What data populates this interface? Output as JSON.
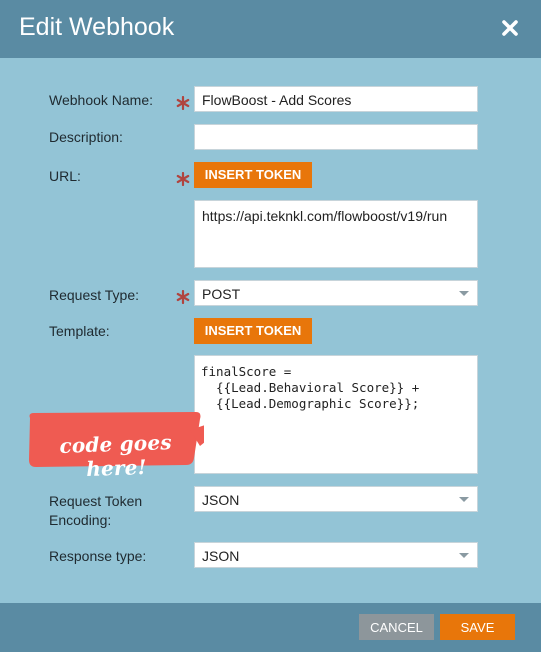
{
  "dialog": {
    "title": "Edit Webhook",
    "close_icon": "close-icon"
  },
  "form": {
    "webhook_name": {
      "label": "Webhook Name:",
      "value": "FlowBoost - Add Scores",
      "required": true
    },
    "description": {
      "label": "Description:",
      "value": ""
    },
    "url": {
      "label": "URL:",
      "insert_token": "INSERT TOKEN",
      "value": "https://api.teknkl.com/flowboost/v19/run",
      "required": true
    },
    "request_type": {
      "label": "Request Type:",
      "value": "POST",
      "required": true
    },
    "template": {
      "label": "Template:",
      "insert_token": "INSERT TOKEN",
      "value": "finalScore =\n  {{Lead.Behavioral Score}} +\n  {{Lead.Demographic Score}};"
    },
    "request_token_encoding": {
      "label_line1": "Request Token",
      "label_line2": "Encoding:",
      "value": "JSON"
    },
    "response_type": {
      "label": "Response type:",
      "value": "JSON"
    }
  },
  "annotation": {
    "text": "code goes here!"
  },
  "footer": {
    "cancel": "CANCEL",
    "save": "SAVE"
  },
  "colors": {
    "background": "#93c4d6",
    "header": "#5a8ba3",
    "accent": "#e8760a",
    "required_star": "#b0443f",
    "callout": "#ef5b52"
  }
}
